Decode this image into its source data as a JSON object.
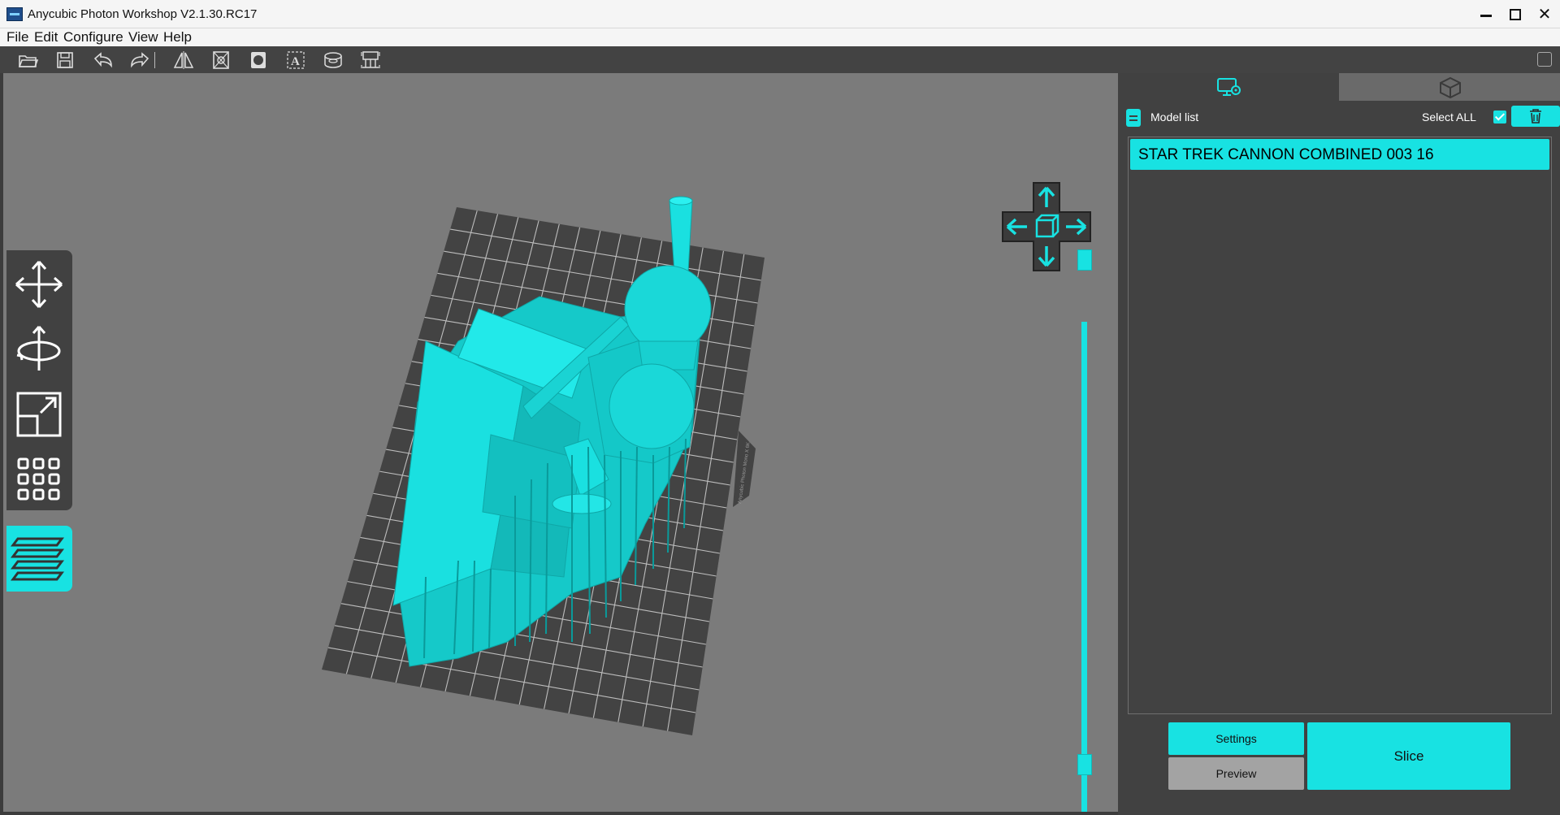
{
  "window": {
    "title": "Anycubic Photon Workshop V2.1.30.RC17",
    "minimize_icon": "minimize-icon",
    "maximize_icon": "maximize-icon",
    "close_glyph": "✕"
  },
  "menu": [
    "File",
    "Edit",
    "Configure",
    "View",
    "Help"
  ],
  "toolbar": {
    "icons": [
      "open-folder-icon",
      "save-icon",
      "undo-icon",
      "redo-icon",
      "mirror-icon",
      "hollow-icon",
      "punch-hole-icon",
      "text-icon",
      "layer-paint-icon",
      "support-icon"
    ]
  },
  "left_tools": [
    "move-icon",
    "rotate-icon",
    "scale-icon",
    "arrange-icon",
    "layers-icon"
  ],
  "model_list": {
    "label": "Model list",
    "select_all_label": "Select ALL",
    "select_all_checked": true,
    "items": [
      "STAR TREK CANNON COMBINED 003  16"
    ]
  },
  "buttons": {
    "settings": "Settings",
    "preview": "Preview",
    "slice": "Slice"
  },
  "plate_label": "Anycubic Photon Mono X 6K",
  "colors": {
    "accent": "#18e2e2",
    "viewport_bg": "#7b7b7b",
    "panel_bg": "#414141",
    "plate": "#434343",
    "grid": "#bfbfbf"
  }
}
